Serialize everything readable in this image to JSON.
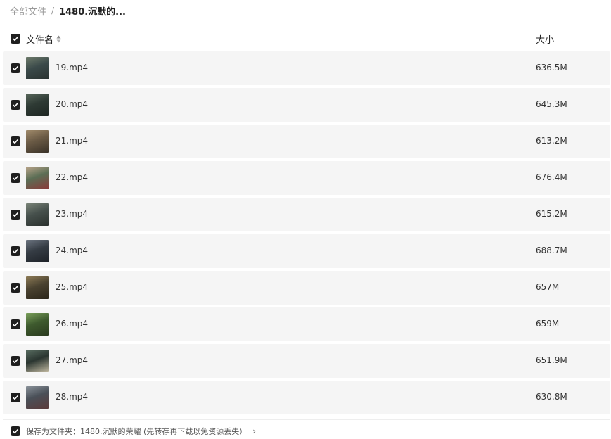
{
  "breadcrumb": {
    "root": "全部文件",
    "separator": "/",
    "current": "1480.沉默的..."
  },
  "header": {
    "name_label": "文件名",
    "size_label": "大小"
  },
  "files": [
    {
      "name": "19.mp4",
      "size": "636.5M",
      "checked": true,
      "thumb_colors": [
        "#3b4a4a",
        "#6d7a6a",
        "#2a3230"
      ]
    },
    {
      "name": "20.mp4",
      "size": "645.3M",
      "checked": true,
      "thumb_colors": [
        "#2e3a34",
        "#57665a",
        "#1e2622"
      ]
    },
    {
      "name": "21.mp4",
      "size": "613.2M",
      "checked": true,
      "thumb_colors": [
        "#6a5a45",
        "#a08a6a",
        "#3a3228"
      ]
    },
    {
      "name": "22.mp4",
      "size": "676.4M",
      "checked": true,
      "thumb_colors": [
        "#5b6e55",
        "#b9a48a",
        "#8a3a3a"
      ]
    },
    {
      "name": "23.mp4",
      "size": "615.2M",
      "checked": true,
      "thumb_colors": [
        "#46504c",
        "#7a8478",
        "#2a302d"
      ]
    },
    {
      "name": "24.mp4",
      "size": "688.7M",
      "checked": true,
      "thumb_colors": [
        "#353c44",
        "#6c7480",
        "#1e2228"
      ]
    },
    {
      "name": "25.mp4",
      "size": "657M",
      "checked": true,
      "thumb_colors": [
        "#4a4230",
        "#8c7a55",
        "#2c261a"
      ]
    },
    {
      "name": "26.mp4",
      "size": "659M",
      "checked": true,
      "thumb_colors": [
        "#3e5a2e",
        "#7aa05a",
        "#2a3a1e"
      ]
    },
    {
      "name": "27.mp4",
      "size": "651.9M",
      "checked": true,
      "thumb_colors": [
        "#2a3530",
        "#5a6e62",
        "#c0b8a0"
      ]
    },
    {
      "name": "28.mp4",
      "size": "630.8M",
      "checked": true,
      "thumb_colors": [
        "#4a5058",
        "#8a929a",
        "#5a3a3a"
      ]
    }
  ],
  "footer": {
    "text": "保存为文件夹：1480.沉默的荣耀 (先转存再下载以免资源丢失）",
    "checked": true
  },
  "colors": {
    "row_background": "#f5f5f5",
    "checkbox_fill": "#1f1f1f",
    "muted_text": "#9a9a9a"
  }
}
